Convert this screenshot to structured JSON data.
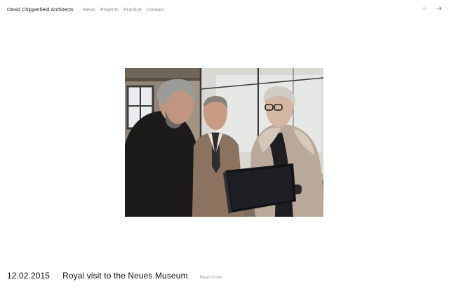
{
  "header": {
    "brand": "David Chipperfield Architects",
    "nav": [
      {
        "label": "News"
      },
      {
        "label": "Projects"
      },
      {
        "label": "Practice"
      },
      {
        "label": "Contact"
      }
    ],
    "prev_icon": "arrow-left-icon",
    "next_icon": "arrow-right-icon"
  },
  "photo": {
    "subject": "photo"
  },
  "article": {
    "date": "12.02.2015",
    "title": "Royal visit to the Neues Museum",
    "read_more": "Read more"
  },
  "colors": {
    "text": "#111111",
    "nav_text": "#8a8a8a",
    "muted": "#9a9a9a",
    "background": "#ffffff"
  }
}
